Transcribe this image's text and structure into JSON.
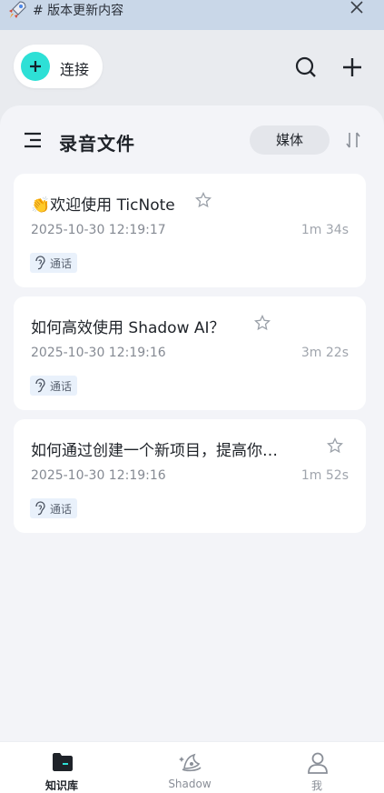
{
  "banner": {
    "text": "# 版本更新内容",
    "icon": "rocket-icon",
    "close_icon": "close-icon"
  },
  "header": {
    "connect_label": "连接",
    "search_icon": "search-icon",
    "add_icon": "plus-icon",
    "accent_color": "#2ee0d6"
  },
  "section": {
    "title": "录音文件",
    "media_button": "媒体",
    "menu_icon": "menu-icon",
    "sort_icon": "sort-icon"
  },
  "recordings": [
    {
      "title": "👏欢迎使用 TicNote",
      "date": "2025-10-30 12:19:17",
      "duration": "1m 34s",
      "tag": "通话",
      "starred": false
    },
    {
      "title": "如何高效使用 Shadow AI？",
      "date": "2025-10-30 12:19:16",
      "duration": "3m 22s",
      "tag": "通话",
      "starred": false
    },
    {
      "title": "如何通过创建一个新项目，提高你…",
      "date": "2025-10-30 12:19:16",
      "duration": "1m 52s",
      "tag": "通话",
      "starred": false
    }
  ],
  "nav": [
    {
      "label": "知识库",
      "icon": "folder-icon",
      "active": true
    },
    {
      "label": "Shadow",
      "icon": "shadow-hat-icon",
      "active": false
    },
    {
      "label": "我",
      "icon": "user-icon",
      "active": false
    }
  ]
}
